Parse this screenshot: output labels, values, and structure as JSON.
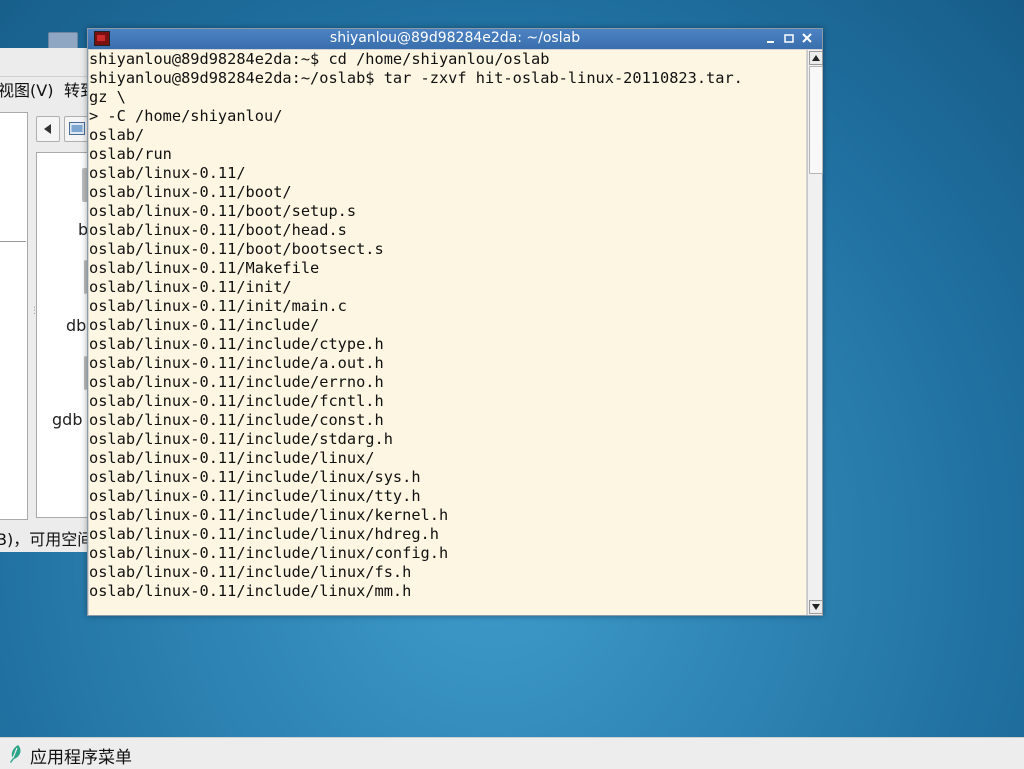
{
  "desktop": {
    "background_color": "#2f86b6"
  },
  "file_manager": {
    "menu_view": "视图(V)",
    "menu_convert": "转到",
    "files": [
      "b",
      "db",
      "gdb"
    ],
    "status_text": "B)，可用空间"
  },
  "terminal": {
    "title": "shiyanlou@89d98284e2da: ~/oslab",
    "colors": {
      "background": "#fdf6e3",
      "titlebar": "#4a7fc0",
      "text": "#111111"
    },
    "lines": [
      "shiyanlou@89d98284e2da:~$ cd /home/shiyanlou/oslab",
      "shiyanlou@89d98284e2da:~/oslab$ tar -zxvf hit-oslab-linux-20110823.tar.",
      "gz \\",
      "> -C /home/shiyanlou/",
      "oslab/",
      "oslab/run",
      "oslab/linux-0.11/",
      "oslab/linux-0.11/boot/",
      "oslab/linux-0.11/boot/setup.s",
      "oslab/linux-0.11/boot/head.s",
      "oslab/linux-0.11/boot/bootsect.s",
      "oslab/linux-0.11/Makefile",
      "oslab/linux-0.11/init/",
      "oslab/linux-0.11/init/main.c",
      "oslab/linux-0.11/include/",
      "oslab/linux-0.11/include/ctype.h",
      "oslab/linux-0.11/include/a.out.h",
      "oslab/linux-0.11/include/errno.h",
      "oslab/linux-0.11/include/fcntl.h",
      "oslab/linux-0.11/include/const.h",
      "oslab/linux-0.11/include/stdarg.h",
      "oslab/linux-0.11/include/linux/",
      "oslab/linux-0.11/include/linux/sys.h",
      "oslab/linux-0.11/include/linux/tty.h",
      "oslab/linux-0.11/include/linux/kernel.h",
      "oslab/linux-0.11/include/linux/hdreg.h",
      "oslab/linux-0.11/include/linux/config.h",
      "oslab/linux-0.11/include/linux/fs.h",
      "oslab/linux-0.11/include/linux/mm.h"
    ]
  },
  "taskbar": {
    "menu_label": "应用程序菜单",
    "menu_icon": "app-menu-leaf-icon"
  }
}
